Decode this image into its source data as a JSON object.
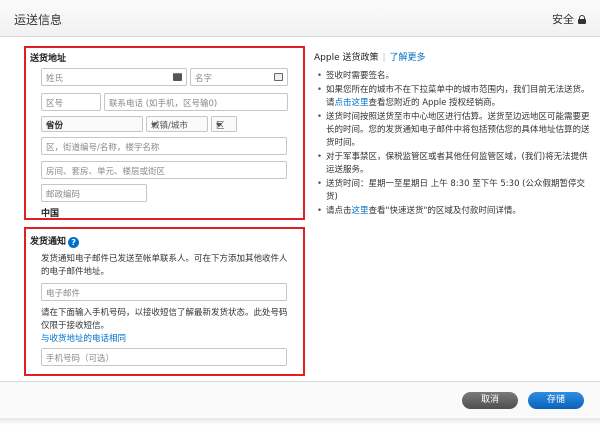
{
  "header": {
    "title": "运送信息",
    "secure_label": "安全"
  },
  "shipping": {
    "title": "送货地址",
    "last_name_placeholder": "姓氏",
    "first_name_placeholder": "名字",
    "area_code_placeholder": "区号",
    "phone_placeholder": "联系电话 (如手机，区号输0)",
    "province_label": "省份",
    "city_label": "城镇/城市",
    "district_label": "区",
    "street_placeholder": "区，街道编号/名称，楼宇名称",
    "unit_placeholder": "房间、套房、单元、楼层或街区",
    "postal_placeholder": "邮政编码",
    "country": "中国"
  },
  "notify": {
    "title": "发货通知",
    "email_desc": "发货通知电子邮件已发送至帐单联系人。可在下方添加其他收件人的电子邮件地址。",
    "email_placeholder": "电子邮件",
    "sms_desc": "请在下面输入手机号码，以接收短信了解最新发货状态。此处号码仅限于接收短信。",
    "same_phone_link": "与收货地址的电话相同",
    "mobile_placeholder": "手机号码（可选）"
  },
  "policy": {
    "title": "Apple 送货政策",
    "learn_more": "了解更多",
    "items": {
      "0": {
        "text": "签收时需要签名。"
      },
      "1": {
        "pre": "如果您所在的城市不在下拉菜单中的城市范围内，我们目前无法送货。请",
        "link": "点击这里",
        "post": "查看您附近的 Apple 授权经销商。"
      },
      "2": {
        "text": "送货时间按照送货至市中心地区进行估算。送货至边远地区可能需要更长的时间。您的发货通知电子邮件中将包括预估您的具体地址估算的送货时间。"
      },
      "3": {
        "text": "对于军事禁区，保税监管区或者其他任何监管区域，(我们)将无法提供运送服务。"
      },
      "4": {
        "text": "送货时间：星期一至星期日 上午 8:30 至下午 5:30 (公众假期暂停交货)"
      },
      "5": {
        "pre": "请点击",
        "link": "这里",
        "post": "查看\"快速送货\"的区域及付款时间详情。"
      }
    }
  },
  "footer": {
    "cancel_label": "取消",
    "save_label": "存储"
  }
}
